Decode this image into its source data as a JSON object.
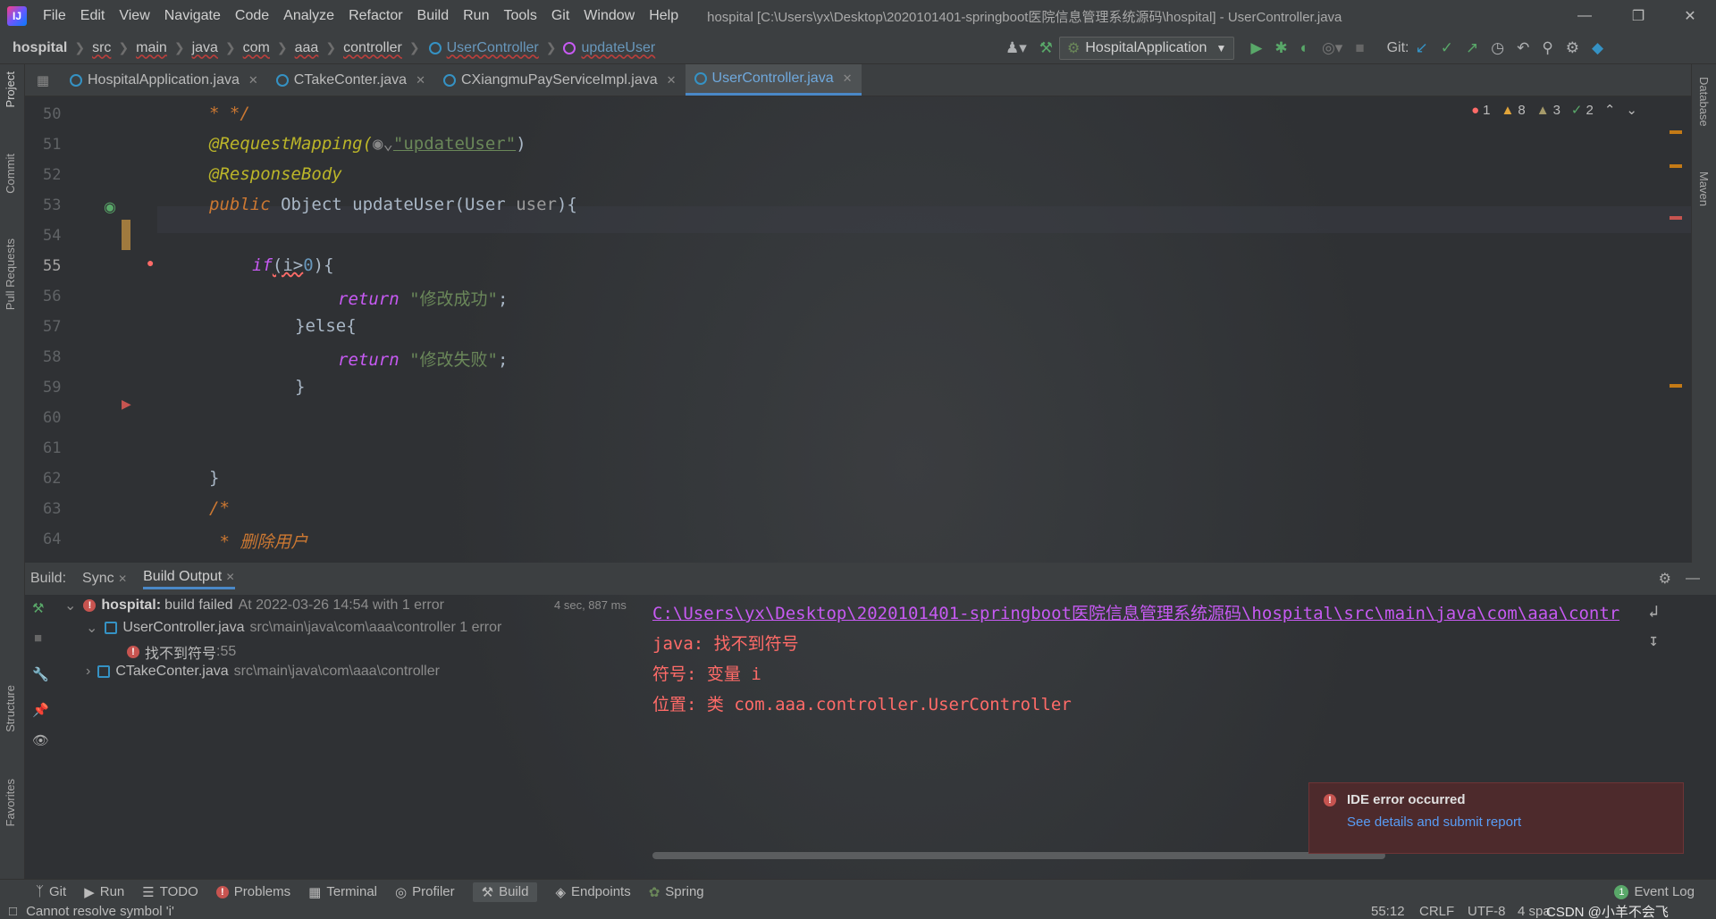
{
  "app": {
    "logo_text": "IJ",
    "menu": [
      "File",
      "Edit",
      "View",
      "Navigate",
      "Code",
      "Analyze",
      "Refactor",
      "Build",
      "Run",
      "Tools",
      "Git",
      "Window",
      "Help"
    ],
    "window_title": "hospital [C:\\Users\\yx\\Desktop\\2020101401-springboot医院信息管理系统源码\\hospital] - UserController.java"
  },
  "breadcrumb": {
    "items": [
      "hospital",
      "src",
      "main",
      "java",
      "com",
      "aaa",
      "controller"
    ],
    "class_name": "UserController",
    "method_name": "updateUser"
  },
  "toolbar": {
    "run_config": "HospitalApplication",
    "git_label": "Git:"
  },
  "left_strip": [
    "Project",
    "Commit",
    "Pull Requests",
    "Structure",
    "Favorites"
  ],
  "right_strip": [
    "Database",
    "Maven"
  ],
  "tabs": [
    {
      "label": "HospitalApplication.java",
      "active": false
    },
    {
      "label": "CTakeConter.java",
      "active": false
    },
    {
      "label": "CXiangmuPayServiceImpl.java",
      "active": false
    },
    {
      "label": "UserController.java",
      "active": true
    }
  ],
  "inspections": {
    "errors": "1",
    "warnings": "8",
    "weak_warnings": "3",
    "typos": "2"
  },
  "editor": {
    "line_numbers": [
      "50",
      "51",
      "52",
      "53",
      "54",
      "55",
      "56",
      "57",
      "58",
      "59",
      "60",
      "61",
      "62",
      "63",
      "64"
    ],
    "lines": {
      "l50": "* */",
      "l51_ann": "@RequestMapping(",
      "l51_str": "\"updateUser\"",
      "l51_end": ")",
      "l52": "@ResponseBody",
      "l53_kw": "public",
      "l53_type": " Object ",
      "l53_fn": "updateUser",
      "l53_rest1": "(User ",
      "l53_param": "user",
      "l53_rest2": "){",
      "l55_kw": "if",
      "l55_rest": "(i>",
      "l55_num": "0",
      "l55_end": "){",
      "l56_kw": "return",
      "l56_str": " \"修改成功\"",
      "l56_end": ";",
      "l57": "}else{",
      "l58_kw": "return",
      "l58_str": " \"修改失败\"",
      "l58_end": ";",
      "l59": "}",
      "l62": "}",
      "l63": "/*",
      "l64": " * 删除用户"
    }
  },
  "build": {
    "header_label": "Build:",
    "tabs": [
      "Sync",
      "Build Output"
    ],
    "tree": {
      "root_name": "hospital:",
      "root_status": "build failed",
      "root_time": "At 2022-03-26 14:54 with 1 error",
      "root_duration": "4 sec, 887 ms",
      "file1": "UserController.java",
      "file1_path": "src\\main\\java\\com\\aaa\\controller 1 error",
      "error_msg": "找不到符号",
      "error_line": ":55",
      "file2": "CTakeConter.java",
      "file2_path": "src\\main\\java\\com\\aaa\\controller"
    },
    "output": {
      "path": "C:\\Users\\yx\\Desktop\\2020101401-springboot医院信息管理系统源码\\hospital\\src\\main\\java\\com\\aaa\\contr",
      "line1": "java: 找不到符号",
      "line2": "  符号:   变量 i",
      "line3": "  位置: 类 com.aaa.controller.UserController"
    }
  },
  "notification": {
    "title": "IDE error occurred",
    "link": "See details and submit report"
  },
  "bottom_tools": [
    "Git",
    "Run",
    "TODO",
    "Problems",
    "Terminal",
    "Profiler",
    "Build",
    "Endpoints",
    "Spring"
  ],
  "event_log": "Event Log",
  "event_log_count": "1",
  "status": {
    "message": "Cannot resolve symbol 'i'",
    "position": "55:12",
    "line_sep": "CRLF",
    "encoding": "UTF-8",
    "indent": "4 spa",
    "watermark": "CSDN @小羊不会飞"
  }
}
